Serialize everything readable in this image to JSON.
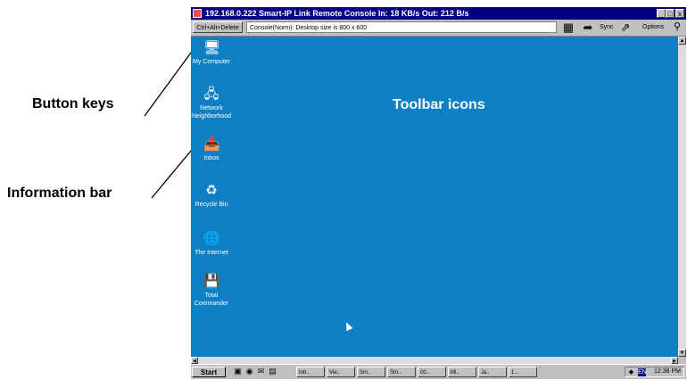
{
  "callouts": {
    "button_keys": "Button keys",
    "information_bar": "Information bar",
    "toolbar_icons": "Toolbar icons"
  },
  "window": {
    "title": "192.168.0.222 Smart-IP Link Remote Console In: 18 KB/s Out: 212 B/s",
    "controls": [
      "_",
      "□",
      "x"
    ]
  },
  "toolbar": {
    "cad_button": "Ctrl+Alt+Delete",
    "info_text": "Console(Norm): Desktop size is 800 x 600",
    "sync_label": "Sync",
    "options_label": "Options",
    "icons": [
      "fit-screen-icon",
      "mouse-pointer-icon",
      "sync-pointer-icon",
      "magnifier-icon"
    ]
  },
  "desktop": {
    "background": "#0f7fc4",
    "icons": [
      {
        "label": "My Computer",
        "icon": "computer-icon"
      },
      {
        "label": "Network Neighborhood",
        "icon": "network-icon"
      },
      {
        "label": "Inbox",
        "icon": "inbox-icon"
      },
      {
        "label": "Recycle Bin",
        "icon": "recycle-bin-icon"
      },
      {
        "label": "The Internet",
        "icon": "internet-icon"
      },
      {
        "label": "Total Commander",
        "icon": "total-commander-icon"
      }
    ]
  },
  "taskbar": {
    "start_label": "Start",
    "tasks": [
      "Inb..",
      "Vie..",
      "Sm..",
      "Sm..",
      "00..",
      "Mi..",
      "Ja..",
      "1..."
    ],
    "tray_lang": "EN",
    "clock": "12:38 PM"
  }
}
